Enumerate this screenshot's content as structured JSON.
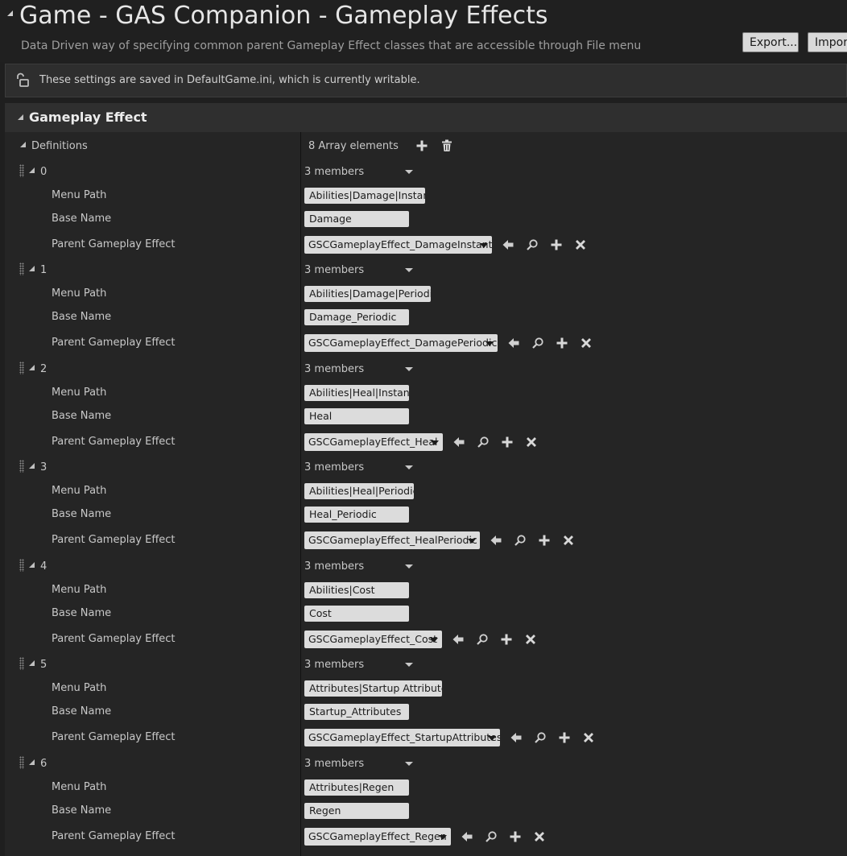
{
  "header": {
    "title": "Game - GAS Companion - Gameplay Effects",
    "subtitle": "Data Driven way of specifying common parent Gameplay Effect classes that are accessible through File menu",
    "export_label": "Export...",
    "import_label": "Import..."
  },
  "notice": {
    "text": "These settings are saved in DefaultGame.ini, which is currently writable.",
    "icon": "unlocked-padlock-icon"
  },
  "category": {
    "title": "Gameplay Effect"
  },
  "definitions": {
    "label": "Definitions",
    "count_text": "8 Array elements",
    "add_icon": "plus-icon",
    "delete_icon": "trash-icon"
  },
  "row_labels": {
    "menu_path": "Menu Path",
    "base_name": "Base Name",
    "parent": "Parent Gameplay Effect"
  },
  "elements": [
    {
      "index": "0",
      "members": "3 members",
      "menu_path": "Abilities|Damage|Instant",
      "base_name": "Damage",
      "parent": "GSCGameplayEffect_DamageInstant"
    },
    {
      "index": "1",
      "members": "3 members",
      "menu_path": "Abilities|Damage|Periodic",
      "base_name": "Damage_Periodic",
      "parent": "GSCGameplayEffect_DamagePeriodic"
    },
    {
      "index": "2",
      "members": "3 members",
      "menu_path": "Abilities|Heal|Instant",
      "base_name": "Heal",
      "parent": "GSCGameplayEffect_Heal"
    },
    {
      "index": "3",
      "members": "3 members",
      "menu_path": "Abilities|Heal|Periodic",
      "base_name": "Heal_Periodic",
      "parent": "GSCGameplayEffect_HealPeriodic"
    },
    {
      "index": "4",
      "members": "3 members",
      "menu_path": "Abilities|Cost",
      "base_name": "Cost",
      "parent": "GSCGameplayEffect_Cost"
    },
    {
      "index": "5",
      "members": "3 members",
      "menu_path": "Attributes|Startup Attributes",
      "base_name": "Startup_Attributes",
      "parent": "GSCGameplayEffect_StartupAttributes"
    },
    {
      "index": "6",
      "members": "3 members",
      "menu_path": "Attributes|Regen",
      "base_name": "Regen",
      "parent": "GSCGameplayEffect_Regen"
    }
  ],
  "colors": {
    "background": "#1f1f1f",
    "panel": "#252525",
    "field": "#dcdcdc",
    "text": "#c8c8c8"
  }
}
